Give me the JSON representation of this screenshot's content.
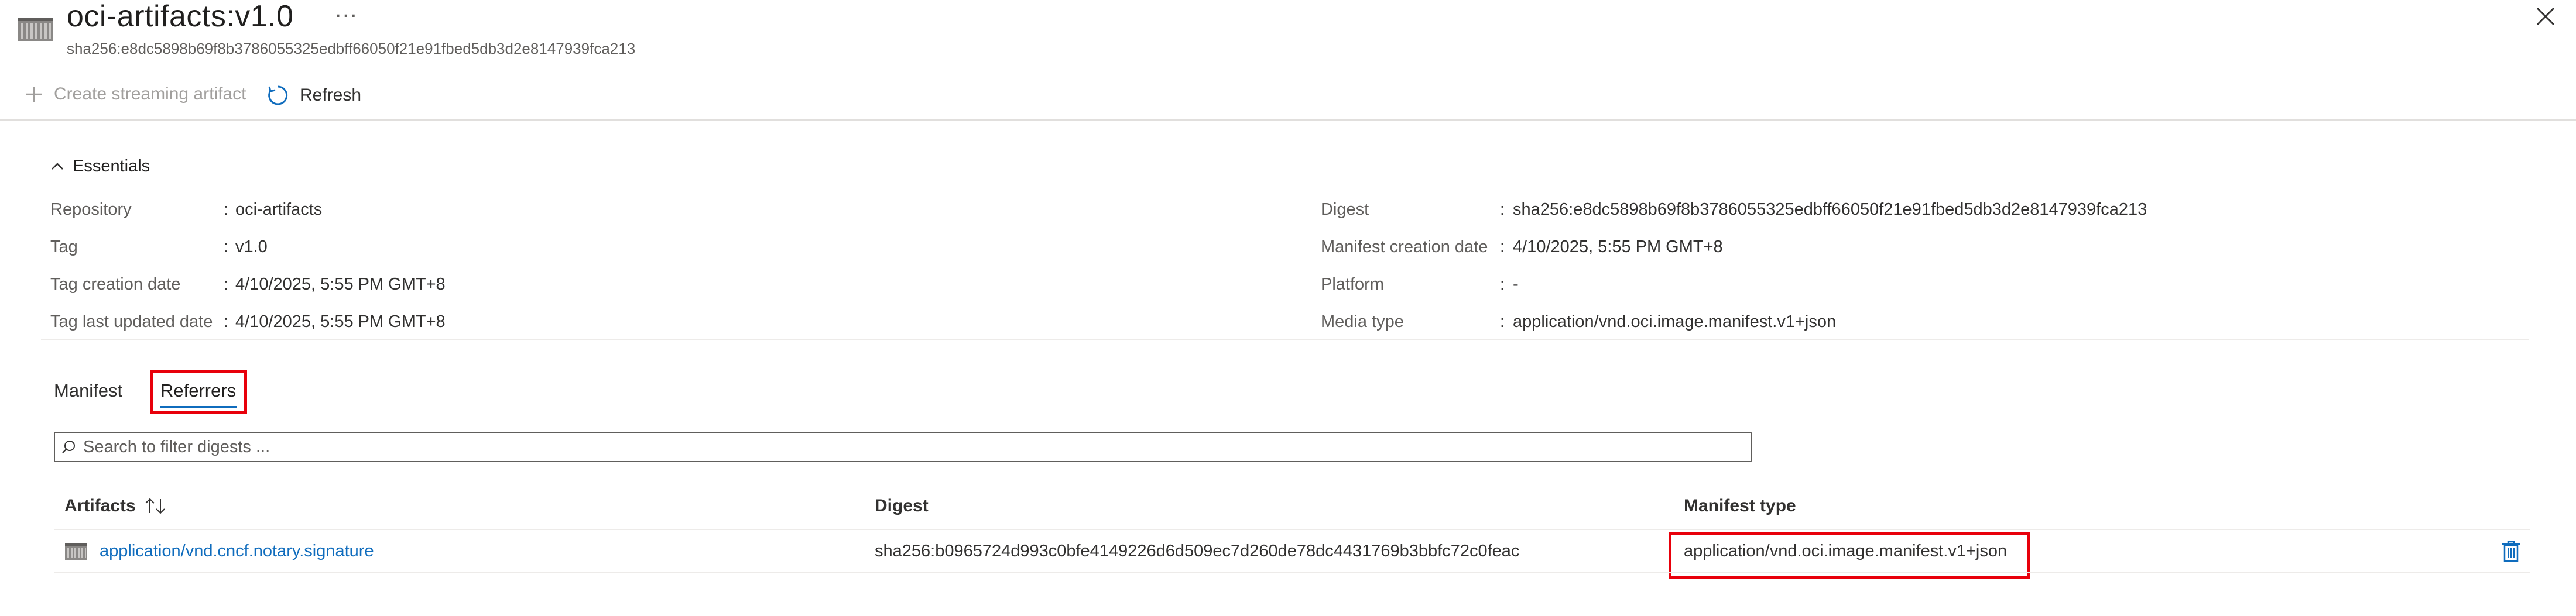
{
  "header": {
    "title": "oci-artifacts:v1.0",
    "more_label": "...",
    "subtitle": "sha256:e8dc5898b69f8b3786055325edbff66050f21e91fbed5db3d2e8147939fca213",
    "icon": "container-image-icon"
  },
  "toolbar": {
    "create_label": "Create streaming artifact",
    "refresh_label": "Refresh"
  },
  "essentials": {
    "label": "Essentials",
    "left": [
      {
        "label": "Repository",
        "value": "oci-artifacts"
      },
      {
        "label": "Tag",
        "value": "v1.0"
      },
      {
        "label": "Tag creation date",
        "value": "4/10/2025, 5:55 PM GMT+8"
      },
      {
        "label": "Tag last updated date",
        "value": "4/10/2025, 5:55 PM GMT+8"
      }
    ],
    "right": [
      {
        "label": "Digest",
        "value": "sha256:e8dc5898b69f8b3786055325edbff66050f21e91fbed5db3d2e8147939fca213"
      },
      {
        "label": "Manifest creation date",
        "value": "4/10/2025, 5:55 PM GMT+8"
      },
      {
        "label": "Platform",
        "value": "-"
      },
      {
        "label": "Media type",
        "value": "application/vnd.oci.image.manifest.v1+json"
      }
    ]
  },
  "tabs": [
    {
      "label": "Manifest",
      "selected": false
    },
    {
      "label": "Referrers",
      "selected": true
    }
  ],
  "search": {
    "placeholder": "Search to filter digests ..."
  },
  "table": {
    "columns": [
      "Artifacts",
      "Digest",
      "Manifest type"
    ],
    "rows": [
      {
        "artifact": "application/vnd.cncf.notary.signature",
        "digest": "sha256:b0965724d993c0bfe4149226d6d509ec7d260de78dc4431769b3bbfc72c0feac",
        "manifest_type": "application/vnd.oci.image.manifest.v1+json"
      }
    ]
  },
  "colors": {
    "accent": "#0f6cbd",
    "highlight": "#e8000b"
  }
}
